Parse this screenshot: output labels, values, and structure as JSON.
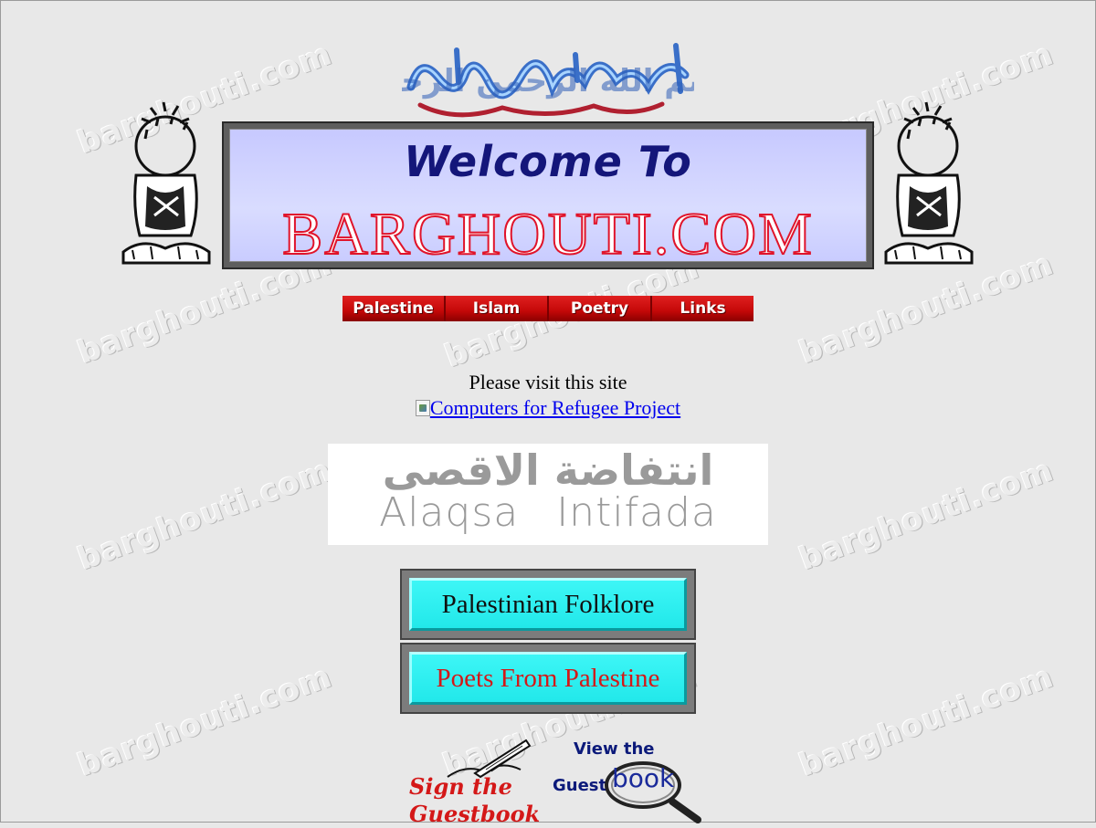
{
  "watermark": "barghouti.com",
  "header": {
    "bismillah": "بسم الله الرحمن الرحيم",
    "welcome": "Welcome To",
    "site_name": "BARGHOUTI.COM"
  },
  "nav": {
    "items": [
      {
        "label": "Palestine"
      },
      {
        "label": "Islam"
      },
      {
        "label": "Poetry"
      },
      {
        "label": "Links"
      }
    ]
  },
  "promo": {
    "visit_text": "Please visit this site",
    "link_text": "Computers for Refugee Project"
  },
  "intifada_banner": {
    "arabic": "انتفاضة الاقصى",
    "english": "Alaqsa Intifada"
  },
  "buttons": {
    "folklore": "Palestinian Folklore",
    "poets": "Poets From Palestine"
  },
  "guestbook": {
    "sign_line1": "Sign the",
    "sign_line2": "Guestbook",
    "view_the": "View the",
    "guest": "Guest",
    "book": "book"
  },
  "colors": {
    "background": "#e8e8e8",
    "nav_red": "#c40808",
    "button_cyan": "#22e8ea",
    "link_blue": "#0000ee",
    "title_navy": "#14167a",
    "title_red": "#e0142b"
  }
}
